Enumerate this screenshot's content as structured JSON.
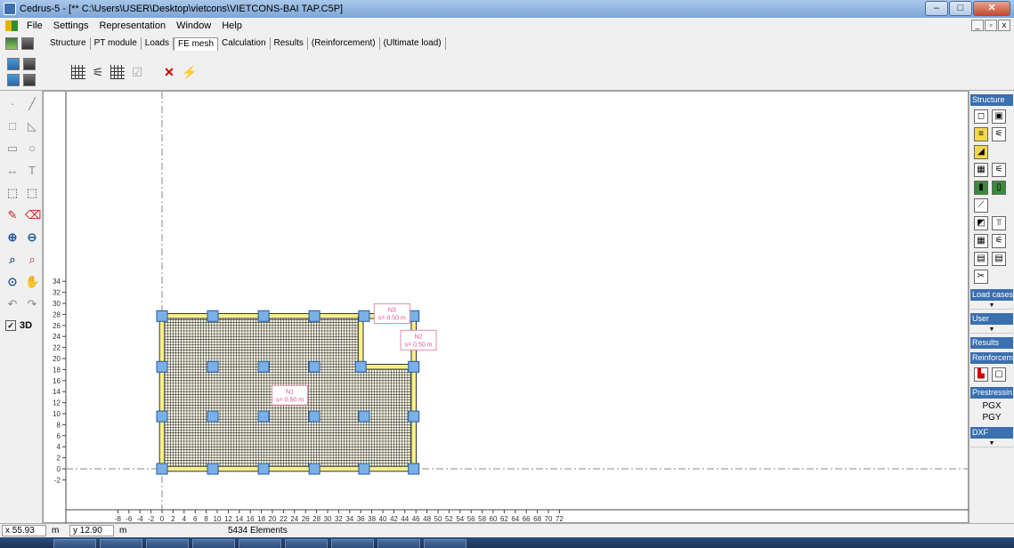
{
  "window": {
    "title": "Cedrus-5 - [** C:\\Users\\USER\\Desktop\\vietcons\\VIETCONS-BAI TAP.C5P]",
    "minimize": "–",
    "maximize": "□",
    "close": "✕"
  },
  "menu": [
    "File",
    "Settings",
    "Representation",
    "Window",
    "Help"
  ],
  "mdi_controls": [
    "_",
    "▫",
    "x"
  ],
  "tabs": [
    {
      "label": "Structure",
      "active": false
    },
    {
      "label": "PT module",
      "active": false
    },
    {
      "label": "Loads",
      "active": false
    },
    {
      "label": "FE mesh",
      "active": true
    },
    {
      "label": "Calculation",
      "active": false
    },
    {
      "label": "Results",
      "active": false
    },
    {
      "label": "(Reinforcement)",
      "active": false
    },
    {
      "label": "(Ultimate load)",
      "active": false
    }
  ],
  "left_panel": {
    "button_3d": "3D"
  },
  "right_panel": {
    "structure": "Structure",
    "load_cases": "Load cases",
    "user": "User",
    "results": "Results",
    "reinforcement": "Reinforcem",
    "prestressing": "Prestressin",
    "pgx": "PGX",
    "pgy": "PGY",
    "dxf": "DXF"
  },
  "canvas": {
    "x_ticks": [
      -8,
      -6,
      -4,
      -2,
      0,
      2,
      4,
      6,
      8,
      10,
      12,
      14,
      16,
      18,
      20,
      22,
      24,
      26,
      28,
      30,
      32,
      34,
      36,
      38,
      40,
      42,
      44,
      46,
      48,
      50,
      52,
      54,
      56,
      58,
      60,
      62,
      64,
      66,
      68,
      70,
      72
    ],
    "y_ticks": [
      34,
      32,
      30,
      28,
      26,
      24,
      22,
      20,
      18,
      16,
      14,
      12,
      10,
      8,
      6,
      4,
      2,
      0,
      -2
    ],
    "plate_labels": [
      {
        "name": "N1",
        "thickness": "s= 0.50 m"
      },
      {
        "name": "N2",
        "thickness": "s= 0.50 m"
      },
      {
        "name": "N3",
        "thickness": "s= 0.50 m"
      }
    ]
  },
  "status": {
    "x_label": "x",
    "x_value": "55.93",
    "x_unit": "m",
    "y_label": "y",
    "y_value": "12.90",
    "y_unit": "m",
    "elements": "5434 Elements"
  }
}
